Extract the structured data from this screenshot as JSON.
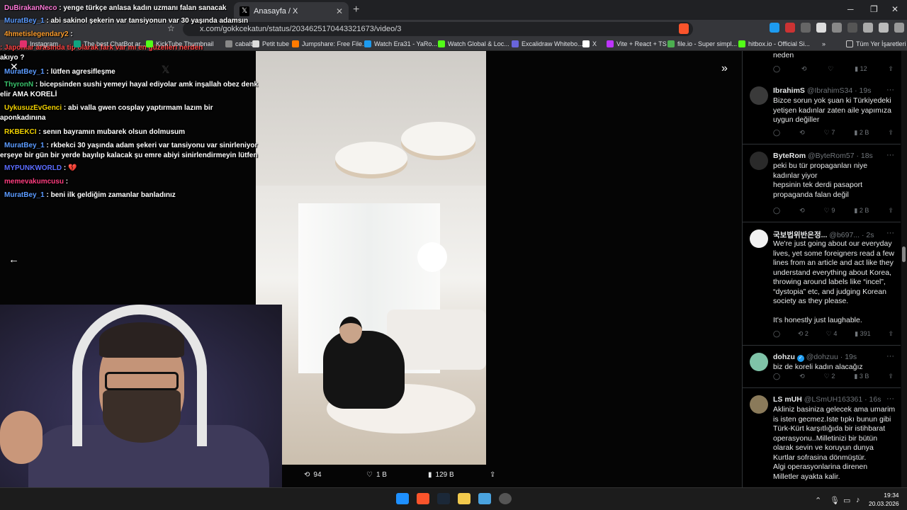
{
  "browser": {
    "tab_title": "Anasayfa / X",
    "url": "x.com/gokkcekatun/status/2034625170443321673/video/3",
    "bookmarks": [
      {
        "label": "Instagram",
        "color": "#e1306c"
      },
      {
        "label": "The best ChatBot ar...",
        "color": "#10a37f"
      },
      {
        "label": "KickTube Thumbnail",
        "color": "#53fc18"
      },
      {
        "label": "cabalt",
        "color": "#888888"
      },
      {
        "label": "Petit tube",
        "color": "#dddddd"
      },
      {
        "label": "Jumpshare: Free File...",
        "color": "#ff7a00"
      },
      {
        "label": "Watch Era31 - YaRo...",
        "color": "#1d9bf0"
      },
      {
        "label": "Watch Global & Loc...",
        "color": "#53fc18"
      },
      {
        "label": "Excalidraw Whitebo...",
        "color": "#6965db"
      },
      {
        "label": "X",
        "color": "#ffffff"
      },
      {
        "label": "Vite + React + TS",
        "color": "#bd34fe"
      },
      {
        "label": "file.io - Super simpl...",
        "color": "#4caf50"
      },
      {
        "label": "hitbox.io - Official Si...",
        "color": "#53fc18"
      }
    ],
    "bookmarks_more": "»",
    "all_bookmarks": "Tüm Yer İşaretleri"
  },
  "chat": [
    {
      "user": "DuBirakanNeco",
      "color": "#ff7ad9",
      "text": ": yenge türkçe anlasa kadın uzmanı falan sanacak"
    },
    {
      "user": "MuratBey_1",
      "color": "#5b9bff",
      "text": ": abi sakinol şekerin var tansiyonun var 30 yaşında adamsın"
    },
    {
      "user": "4hmetislegendary2",
      "color": "#ff9f2e",
      "text": ":"
    },
    {
      "user": "",
      "color": "#ff4444",
      "text": ": Japonlar arasında tip olarak fark var mı en güzelleri nerden"
    },
    {
      "user": "",
      "color": "#ffffff",
      "text": "akıyo ?"
    },
    {
      "user": "MuratBey_1",
      "color": "#5b9bff",
      "text": ": lütfen agresifleşme"
    },
    {
      "user": "ThyronN",
      "color": "#39c26b",
      "text": ": bicepsinden sushi yemeyi hayal ediyolar amk inşallah obez denk"
    },
    {
      "user": "",
      "color": "#ffffff",
      "text": "elir AMA KORELİ"
    },
    {
      "user": "UykusuzEvGenci",
      "color": "#f0d000",
      "text": ": abi valla gwen cosplay yaptırmam lazım bir"
    },
    {
      "user": "",
      "color": "#ffffff",
      "text": "aponkadınına"
    },
    {
      "user": "RKBEKCI",
      "color": "#f0d000",
      "text": ": senın bayramın mubarek olsun dolmusum"
    },
    {
      "user": "MuratBey_1",
      "color": "#5b9bff",
      "text": ": rkbekci 30 yaşında adam şekeri var tansiyonu var sinirleniyor"
    },
    {
      "user": "",
      "color": "#ffffff",
      "text": "erşeye bir gün bir yerde bayılıp kalacak şu emre abiyi sinirlendirmeyin lütfen"
    },
    {
      "user": "MYPUNKWORLD",
      "color": "#5b6cff",
      "text": ": 💔"
    },
    {
      "user": "memevakumcusu",
      "color": "#ff3d7f",
      "text": ":"
    },
    {
      "user": "MuratBey_1",
      "color": "#5b9bff",
      "text": ": beni ilk geldiğim zamanlar banladınız"
    }
  ],
  "video_actions": {
    "retweets": "94",
    "likes": "1 B",
    "views": "129 B"
  },
  "replies_top_stats": {
    "views": "12"
  },
  "replies": [
    {
      "name": "IbrahimS",
      "handle": "@IbrahimS34 · 19s",
      "verified": false,
      "avatar_color": "#3a3a3a",
      "text": "Bizce sorun yok şuan ki Türkiyedeki\nyetişen kadınlar zaten aile yapımıza\nuygun değiller",
      "retweets": "",
      "likes": "7",
      "views": "2 B"
    },
    {
      "name": "ByteRom",
      "handle": "@ByteRom57 · 18s",
      "verified": false,
      "avatar_color": "#2a2a2a",
      "text": "peki bu tür propaganları niye\nkadınlar yiyor\nhepsinin tek derdi pasaport\npropaganda falan değil",
      "retweets": "",
      "likes": "9",
      "views": "2 B"
    },
    {
      "name": "국보법위반은정...",
      "handle": "@b697... · 2s",
      "verified": false,
      "avatar_color": "#f2f2f2",
      "text": "We're just going about our everyday\nlives, yet some foreigners read a few\nlines from an article and act like they\nunderstand everything about Korea,\nthrowing around labels like “incel”,\n“dystopia” etc,  and judging Korean\nsociety as they please.\n\nIt's honestly just laughable.",
      "retweets": "2",
      "likes": "4",
      "views": "391"
    },
    {
      "name": "dohzu",
      "handle": "@dohzuu · 19s",
      "verified": true,
      "avatar_color": "#7fc3a8",
      "text": "biz de koreli kadın alacağız",
      "retweets": "",
      "likes": "2",
      "views": "3 B"
    },
    {
      "name": "LS mUH",
      "handle": "@LSmUH163361 · 16s",
      "verified": false,
      "avatar_color": "#8a7a5a",
      "text": "Akliniz basiniza gelecek ama umarim\nis isten gecmez.Iste tıpkı bunun gibi\nTürk-Kürt karşıtlığıda bir istihbarat\noperasyonu..Milletinizi bir bütün\nolarak sevin ve koruyun dunya\nKurtlar sofrasina dönmüştür.\nAlgi operasyonlarina direnen\nMilletler ayakta kalir.",
      "retweets": "",
      "likes": "",
      "views": ""
    }
  ],
  "top_reply_tail": "neden",
  "taskbar": {
    "time": "19:34",
    "date": "20.03.2026"
  }
}
